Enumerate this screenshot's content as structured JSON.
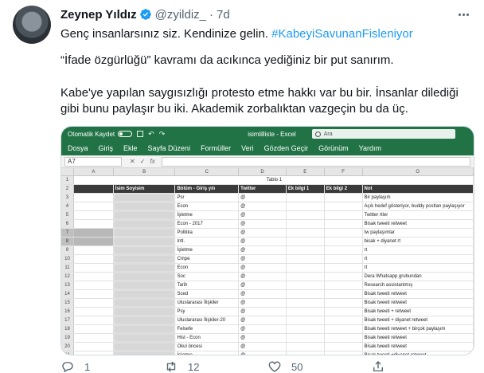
{
  "tweet": {
    "display_name": "Zeynep Yıldız",
    "handle": "@zyildiz_",
    "separator": "·",
    "time": "7d",
    "line1_text": "Genç insanlarsınız siz. Kendinize gelin. ",
    "hashtag": "#KabeyiSavunanFisleniyor",
    "line2": "“İfade özgürlüğü” kavramı da acıkınca yediğiniz bir put sanırım.",
    "line3": "Kabe'ye yapılan saygısızlığı protesto etme hakkı var bu bir. İnsanlar dilediği gibi bunu paylaşır bu iki. Akademik zorbalıktan vazgeçin bu da üç.",
    "colors": {
      "hashtag": "#1d9bf0",
      "verified": "#1d9bf0",
      "excel_green": "#217346"
    }
  },
  "excel": {
    "autosave_label": "Otomatik Kaydet",
    "workbook_title": "isimlilliste  -  Excel",
    "search_placeholder": "Ara",
    "ribbon_tabs": [
      "Dosya",
      "Giriş",
      "Ekle",
      "Sayfa Düzeni",
      "Formüller",
      "Veri",
      "Gözden Geçir",
      "Görünüm",
      "Yardım"
    ],
    "name_box": "A7",
    "fx_label": "fx",
    "columns": [
      "A",
      "B",
      "C",
      "D",
      "E",
      "F",
      "G"
    ],
    "table_title": "Tablo 1",
    "headers": [
      "İsim Soyisim",
      "Bölüm - Giriş yılı",
      "Twitter",
      "Ek bilgi 1",
      "Ek bilgi 2",
      "Not"
    ],
    "rows": [
      {
        "n": "3",
        "c": "Psr",
        "d": "@",
        "g": "Bir paylaşım"
      },
      {
        "n": "4",
        "c": "Econ",
        "d": "@",
        "g": "Açık hedef gösteriyor, buddy postları paylaşıyor"
      },
      {
        "n": "5",
        "c": "İşletme",
        "d": "@",
        "g": "Twitter rtler"
      },
      {
        "n": "6",
        "c": "Econ - 2017",
        "d": "@",
        "g": "Bisak tweeti retweet"
      },
      {
        "n": "7",
        "c": "Politika",
        "d": "@",
        "g": "tw paylaşımlar"
      },
      {
        "n": "8",
        "c": "Intl.",
        "d": "@",
        "g": "bisak + diyanet rt"
      },
      {
        "n": "9",
        "c": "İşletme",
        "d": "@",
        "g": "rt"
      },
      {
        "n": "10",
        "c": "Cmpe",
        "d": "@",
        "g": "rt"
      },
      {
        "n": "11",
        "c": "Econ",
        "d": "@",
        "g": "rt"
      },
      {
        "n": "12",
        "c": "Soc",
        "d": "@",
        "g": "Dera Whatsapp grubundan"
      },
      {
        "n": "13",
        "c": "Tarih",
        "d": "@",
        "g": "Research assistantmış"
      },
      {
        "n": "14",
        "c": "Sced",
        "d": "@",
        "g": "Bisak tweeti retweet"
      },
      {
        "n": "15",
        "c": "Uluslararası İlişkiler",
        "d": "@",
        "g": "Bisak tweeti retweet"
      },
      {
        "n": "16",
        "c": "Psy",
        "d": "@",
        "g": "Bisak tweeti +                retweet"
      },
      {
        "n": "17",
        "c": "Uluslararası İlişkiler-20",
        "d": "@",
        "g": "Bisak tweeti + diyanet retweet"
      },
      {
        "n": "18",
        "c": "Felsefe",
        "d": "@",
        "g": "Bisak tweeti retweet + birçok paylaşım"
      },
      {
        "n": "19",
        "c": "Hist - Econ",
        "d": "@",
        "g": "Bisak tweeti retweet"
      },
      {
        "n": "20",
        "c": "Okul öncesi",
        "d": "@",
        "g": "Bisak tweeti retweet"
      },
      {
        "n": "21",
        "c": "İşletme",
        "d": "@",
        "g": "Bisak tweeti +diyanet retweet"
      }
    ]
  },
  "actions": {
    "reply_count": "1",
    "retweet_count": "12",
    "like_count": "50",
    "icons": [
      "reply-icon",
      "retweet-icon",
      "like-icon",
      "share-icon"
    ]
  }
}
